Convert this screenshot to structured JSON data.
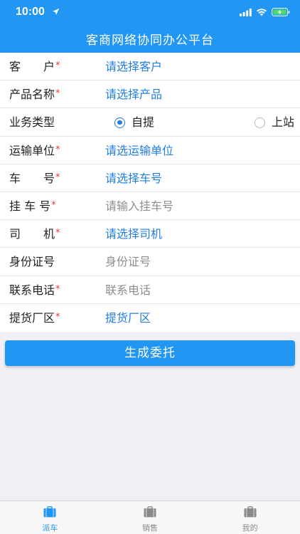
{
  "status_bar": {
    "time": "10:00"
  },
  "header": {
    "title": "客商网络协同办公平台"
  },
  "form": {
    "customer": {
      "label": "客　　户",
      "required": "*",
      "value": "请选择客户"
    },
    "product": {
      "label": "产品名称",
      "required": "*",
      "value": "请选择产品"
    },
    "business_type": {
      "label": "业务类型",
      "options": [
        "自提",
        "上站"
      ],
      "selected": "自提"
    },
    "carrier": {
      "label": "运输单位",
      "required": "*",
      "value": "请选运输单位"
    },
    "vehicle": {
      "label": "车　　号",
      "required": "*",
      "value": "请选择车号"
    },
    "trailer": {
      "label": "挂 车 号",
      "required": "*",
      "placeholder": "请输入挂车号"
    },
    "driver": {
      "label": "司　　机",
      "required": "*",
      "value": "请选择司机"
    },
    "id_number": {
      "label": "身份证号",
      "placeholder": "身份证号"
    },
    "phone": {
      "label": "联系电话",
      "required": "*",
      "placeholder": "联系电话"
    },
    "pickup_area": {
      "label": "提货厂区",
      "required": "*",
      "value": "提货厂区"
    }
  },
  "submit_label": "生成委托",
  "tabs": [
    {
      "label": "派车",
      "icon": "briefcase-icon",
      "active": true
    },
    {
      "label": "销售",
      "icon": "briefcase-icon",
      "active": false
    },
    {
      "label": "我的",
      "icon": "briefcase-icon",
      "active": false
    }
  ],
  "colors": {
    "primary": "#2196f3",
    "link": "#1f7ee0",
    "required": "#e53935",
    "battery": "#4cd964"
  }
}
